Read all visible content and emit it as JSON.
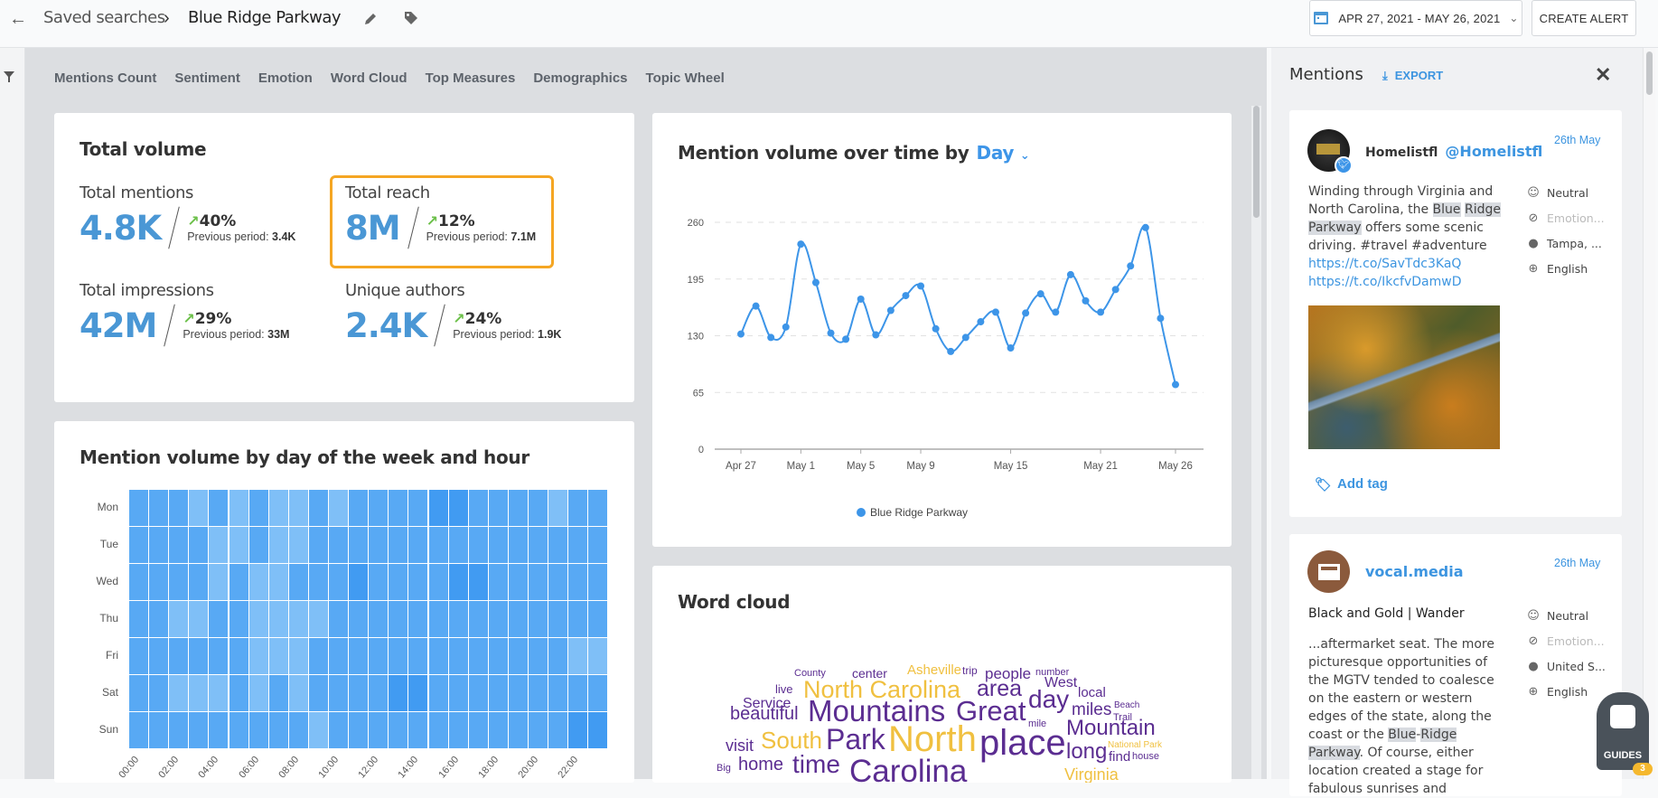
{
  "header": {
    "back_icon": "arrow-left-icon",
    "breadcrumb_parent": "Saved searches",
    "breadcrumb_separator_icon": "chevron-right-icon",
    "title": "Blue Ridge Parkway",
    "edit_icon": "pencil-icon",
    "tag_icon": "tag-icon",
    "date_range": "APR 27, 2021 - MAY 26, 2021",
    "create_alert": "CREATE ALERT"
  },
  "tabs": [
    "Mentions Count",
    "Sentiment",
    "Emotion",
    "Word Cloud",
    "Top Measures",
    "Demographics",
    "Topic Wheel"
  ],
  "total_volume": {
    "title": "Total volume",
    "stats": [
      {
        "label": "Total mentions",
        "value": "4.8K",
        "change": "40%",
        "prev_label": "Previous period:",
        "prev_value": "3.4K"
      },
      {
        "label": "Total reach",
        "value": "8M",
        "change": "12%",
        "prev_label": "Previous period:",
        "prev_value": "7.1M",
        "highlighted": true
      },
      {
        "label": "Total impressions",
        "value": "42M",
        "change": "29%",
        "prev_label": "Previous period:",
        "prev_value": "33M"
      },
      {
        "label": "Unique authors",
        "value": "2.4K",
        "change": "24%",
        "prev_label": "Previous period:",
        "prev_value": "1.9K"
      }
    ],
    "highlight_color": "#f5a623",
    "up_color": "#6cc04a"
  },
  "chart_data": [
    {
      "type": "heatmap",
      "title": "Mention volume by day of the week and hour",
      "rows": [
        "Mon",
        "Tue",
        "Wed",
        "Thu",
        "Fri",
        "Sat",
        "Sun"
      ],
      "columns": [
        "00:00",
        "01:00",
        "02:00",
        "03:00",
        "04:00",
        "05:00",
        "06:00",
        "07:00",
        "08:00",
        "09:00",
        "10:00",
        "11:00",
        "12:00",
        "13:00",
        "14:00",
        "15:00",
        "16:00",
        "17:00",
        "18:00",
        "19:00",
        "20:00",
        "21:00",
        "22:00",
        "23:00"
      ],
      "tick_labels": [
        "00:00",
        "02:00",
        "04:00",
        "06:00",
        "08:00",
        "10:00",
        "12:00",
        "14:00",
        "16:00",
        "18:00",
        "20:00",
        "22:00"
      ],
      "relative_intensity": [
        [
          2,
          2,
          2,
          1,
          2,
          1,
          2,
          1,
          1,
          2,
          1,
          2,
          2,
          2,
          2,
          3,
          3,
          2,
          2,
          2,
          2,
          1,
          2,
          2
        ],
        [
          2,
          2,
          2,
          2,
          1,
          1,
          2,
          1,
          1,
          2,
          2,
          2,
          2,
          2,
          2,
          2,
          2,
          2,
          2,
          2,
          2,
          2,
          2,
          2
        ],
        [
          2,
          2,
          2,
          2,
          1,
          2,
          1,
          1,
          2,
          2,
          2,
          3,
          2,
          2,
          2,
          2,
          3,
          3,
          2,
          2,
          2,
          2,
          2,
          2
        ],
        [
          2,
          2,
          1,
          1,
          2,
          2,
          1,
          1,
          1,
          1,
          2,
          2,
          2,
          2,
          2,
          2,
          2,
          2,
          2,
          2,
          2,
          2,
          2,
          2
        ],
        [
          2,
          2,
          2,
          2,
          2,
          2,
          1,
          1,
          1,
          2,
          2,
          2,
          2,
          2,
          2,
          2,
          2,
          2,
          2,
          2,
          2,
          2,
          1,
          1
        ],
        [
          2,
          2,
          1,
          1,
          1,
          2,
          1,
          2,
          1,
          2,
          2,
          2,
          2,
          3,
          3,
          2,
          2,
          2,
          2,
          2,
          2,
          2,
          2,
          2
        ],
        [
          2,
          2,
          2,
          2,
          2,
          2,
          2,
          2,
          2,
          1,
          2,
          2,
          2,
          2,
          2,
          2,
          2,
          2,
          2,
          2,
          2,
          2,
          3,
          3
        ]
      ],
      "colors": [
        "#7fbff7",
        "#58a9f4",
        "#419bf2"
      ]
    },
    {
      "type": "line",
      "title": "Mention volume over time by",
      "granularity": "Day",
      "x_start": "2021-04-27",
      "x_end": "2021-05-26",
      "x_tick_labels": [
        "Apr 27",
        "May 1",
        "May 5",
        "May 9",
        "May 15",
        "May 21",
        "May 26"
      ],
      "x_tick_days": [
        0,
        4,
        8,
        12,
        18,
        24,
        29
      ],
      "y_ticks": [
        0,
        65,
        130,
        195,
        260
      ],
      "ylim": [
        0,
        260
      ],
      "grid": "horizontal dashed",
      "legend_position": "bottom",
      "series": [
        {
          "name": "Blue Ridge Parkway",
          "color": "#3d95e8",
          "values": [
            132,
            164,
            128,
            140,
            235,
            191,
            133,
            126,
            172,
            131,
            159,
            176,
            187,
            138,
            112,
            128,
            146,
            157,
            116,
            156,
            178,
            157,
            200,
            170,
            157,
            183,
            210,
            254,
            150,
            74
          ]
        }
      ]
    }
  ],
  "word_cloud": {
    "title": "Word cloud",
    "colors": {
      "purple": "#5b2d91",
      "gold": "#f0c040"
    },
    "words": [
      {
        "text": "County",
        "color": "purple"
      },
      {
        "text": "center",
        "color": "purple"
      },
      {
        "text": "Asheville",
        "color": "gold"
      },
      {
        "text": "trip",
        "color": "purple"
      },
      {
        "text": "people",
        "color": "purple"
      },
      {
        "text": "number",
        "color": "purple"
      },
      {
        "text": "live",
        "color": "purple"
      },
      {
        "text": "North Carolina",
        "color": "gold"
      },
      {
        "text": "area",
        "color": "purple"
      },
      {
        "text": "West",
        "color": "purple"
      },
      {
        "text": "local",
        "color": "purple"
      },
      {
        "text": "Service",
        "color": "purple"
      },
      {
        "text": "day",
        "color": "purple"
      },
      {
        "text": "Beach",
        "color": "purple"
      },
      {
        "text": "beautiful",
        "color": "purple"
      },
      {
        "text": "Mountains",
        "color": "purple"
      },
      {
        "text": "Great",
        "color": "purple"
      },
      {
        "text": "miles",
        "color": "purple"
      },
      {
        "text": "Trail",
        "color": "purple"
      },
      {
        "text": "mile",
        "color": "purple"
      },
      {
        "text": "Mountain",
        "color": "purple"
      },
      {
        "text": "visit",
        "color": "purple"
      },
      {
        "text": "South",
        "color": "gold"
      },
      {
        "text": "Park",
        "color": "purple"
      },
      {
        "text": "North",
        "color": "gold"
      },
      {
        "text": "place",
        "color": "purple"
      },
      {
        "text": "National Park",
        "color": "gold"
      },
      {
        "text": "long",
        "color": "purple"
      },
      {
        "text": "find",
        "color": "purple"
      },
      {
        "text": "house",
        "color": "purple"
      },
      {
        "text": "Big",
        "color": "purple"
      },
      {
        "text": "home",
        "color": "purple"
      },
      {
        "text": "time",
        "color": "purple"
      },
      {
        "text": "Carolina",
        "color": "purple"
      },
      {
        "text": "Virginia",
        "color": "gold"
      }
    ]
  },
  "mentions_panel": {
    "title": "Mentions",
    "export": "EXPORT",
    "close_icon": "close-icon",
    "items": [
      {
        "author": "Homelistfl",
        "handle": "@Homelistfl",
        "source_icon": "twitter-icon",
        "date": "26th May",
        "text_before": "Winding through Virginia and North Carolina, the ",
        "hl1": "Blue",
        "hl2": "Ridge",
        "hl3": "Parkway",
        "text_after": " offers some scenic driving. #travel #adventure",
        "link1": "https://t.co/SavTdc3KaQ",
        "link2": "https://t.co/IkcfvDamwD",
        "sentiment": "Neutral",
        "emotion": "Emotion...",
        "location": "Tampa, ...",
        "language": "English",
        "add_tag": "Add tag"
      },
      {
        "author": "vocal.media",
        "source_icon": "news-icon",
        "date": "26th May",
        "title": "Black and Gold | Wander",
        "text_before": "...aftermarket seat. The more picturesque opportunities of the MGTV tended to coalesce on the eastern or western edges of the state, along the coast or the ",
        "hl1": "Blue",
        "hl_sep": "-",
        "hl2": "Ridge",
        "hl3": "Parkway",
        "text_after": ". Of course, either location created a stage for fabulous sunrises and",
        "sentiment": "Neutral",
        "emotion": "Emotion...",
        "location": "United S...",
        "language": "English"
      }
    ]
  },
  "guides": {
    "label": "GUIDES",
    "badge": "3"
  }
}
